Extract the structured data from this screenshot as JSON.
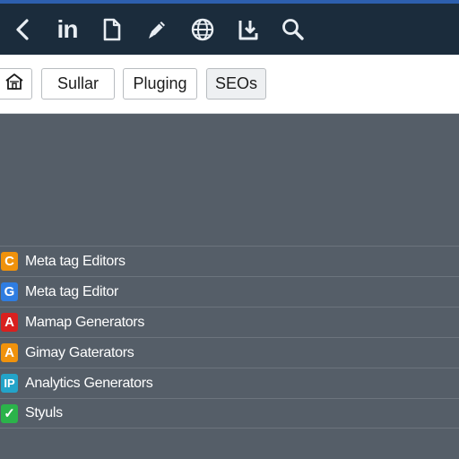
{
  "topbar": {
    "back_icon": "chevron-left-icon",
    "linkedin_text": "in",
    "document_icon": "document-icon",
    "pen_icon": "pen-icon",
    "globe_icon": "globe-icon",
    "download_icon": "download-icon",
    "search_icon": "search-icon",
    "bg_color": "#1b2c3c",
    "accent_color": "#2d5fae"
  },
  "toolbar": {
    "home_icon": "home-icon",
    "buttons": [
      {
        "label": "Sullar",
        "active": false
      },
      {
        "label": "Pluging",
        "active": false
      },
      {
        "label": "SEOs",
        "active": true
      }
    ]
  },
  "list": {
    "items": [
      {
        "badge": "C",
        "badge_color": "#f0920c",
        "label": "Meta tag Editors"
      },
      {
        "badge": "G",
        "badge_color": "#2f7de1",
        "label": "Meta tag Editor"
      },
      {
        "badge": "A",
        "badge_color": "#d8201f",
        "label": "Mamap Generators"
      },
      {
        "badge": "A",
        "badge_color": "#f0920c",
        "label": "Gimay Gaterators"
      },
      {
        "badge": "IP",
        "badge_color": "#23a4c9",
        "label": "Analytics Generators"
      },
      {
        "badge": "✓",
        "badge_color": "#2bb34a",
        "label": "Styuls"
      }
    ]
  },
  "colors": {
    "content_bg": "#555e68",
    "divider": "#6c747d"
  }
}
